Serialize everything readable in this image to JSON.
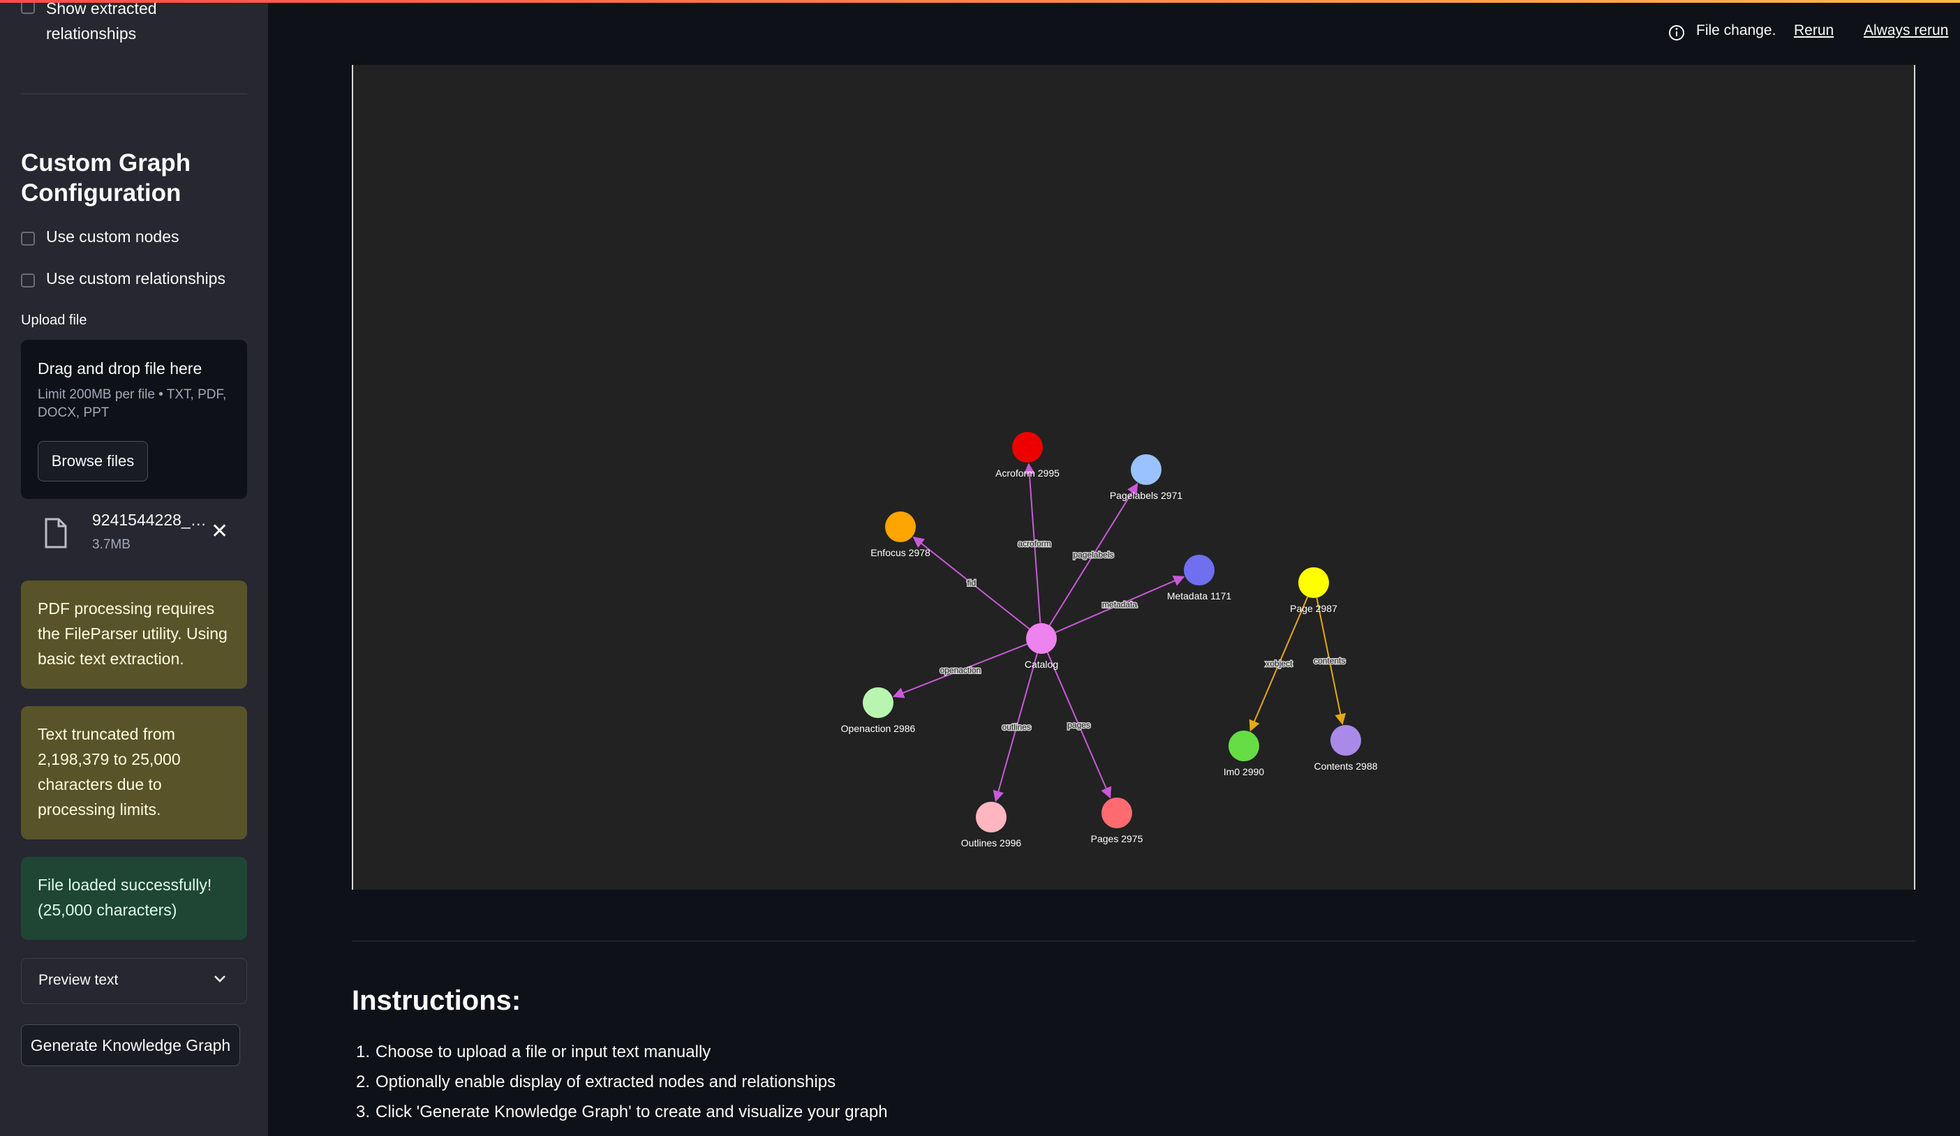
{
  "sidebar": {
    "show_extracted_relationships": "Show extracted relationships",
    "custom_heading": "Custom Graph Configuration",
    "use_custom_nodes": "Use custom nodes",
    "use_custom_relationships": "Use custom relationships",
    "upload_label": "Upload file",
    "dropzone_title": "Drag and drop file here",
    "dropzone_limit": "Limit 200MB per file • TXT, PDF, DOCX, PPT",
    "browse_label": "Browse files",
    "file_name": "9241544228_e…",
    "file_size": "3.7MB",
    "alert_pdf": "PDF processing requires the FileParser utility. Using basic text extraction.",
    "alert_truncated": "Text truncated from 2,198,379 to 25,000 characters due to processing limits.",
    "alert_loaded": "File loaded successfully! (25,000 characters)",
    "preview_label": "Preview text",
    "generate_label": "Generate Knowledge Graph"
  },
  "header": {
    "status": "File change.",
    "rerun": "Rerun",
    "always_rerun": "Always rerun"
  },
  "graph": {
    "nodes": [
      {
        "id": "catalog",
        "label": "Catalog",
        "color": "#ee82ee"
      },
      {
        "id": "acroform",
        "label": "Acroform 2995",
        "color": "#ee0000"
      },
      {
        "id": "pagelabels",
        "label": "Pagelabels 2971",
        "color": "#99c2ff"
      },
      {
        "id": "enfocus",
        "label": "Enfocus 2978",
        "color": "#ffa500"
      },
      {
        "id": "metadata",
        "label": "Metadata 1171",
        "color": "#6f6ff0"
      },
      {
        "id": "openaction",
        "label": "Openaction 2986",
        "color": "#b8f5b0"
      },
      {
        "id": "outlines",
        "label": "Outlines 2996",
        "color": "#ffb6c1"
      },
      {
        "id": "pages",
        "label": "Pages 2975",
        "color": "#ff6b70"
      },
      {
        "id": "page",
        "label": "Page 2987",
        "color": "#ffff00"
      },
      {
        "id": "im0",
        "label": "Im0 2990",
        "color": "#66dd44"
      },
      {
        "id": "contents",
        "label": "Contents 2988",
        "color": "#a98ae8"
      }
    ],
    "edges": [
      {
        "from": "catalog",
        "to": "acroform",
        "label": "acroform",
        "color": "#c85ad8"
      },
      {
        "from": "catalog",
        "to": "pagelabels",
        "label": "pagelabels",
        "color": "#c85ad8"
      },
      {
        "from": "catalog",
        "to": "enfocus",
        "label": "fid",
        "color": "#c85ad8"
      },
      {
        "from": "catalog",
        "to": "metadata",
        "label": "metadata",
        "color": "#c85ad8"
      },
      {
        "from": "catalog",
        "to": "openaction",
        "label": "openaction",
        "color": "#c85ad8"
      },
      {
        "from": "catalog",
        "to": "outlines",
        "label": "outlines",
        "color": "#c85ad8"
      },
      {
        "from": "catalog",
        "to": "pages",
        "label": "pages",
        "color": "#c85ad8"
      },
      {
        "from": "page",
        "to": "im0",
        "label": "xobject",
        "color": "#e6a817"
      },
      {
        "from": "page",
        "to": "contents",
        "label": "contents",
        "color": "#e6a817"
      }
    ]
  },
  "instructions": {
    "heading": "Instructions:",
    "steps": [
      "Choose to upload a file or input text manually",
      "Optionally enable display of extracted nodes and relationships",
      "Click 'Generate Knowledge Graph' to create and visualize your graph"
    ]
  }
}
